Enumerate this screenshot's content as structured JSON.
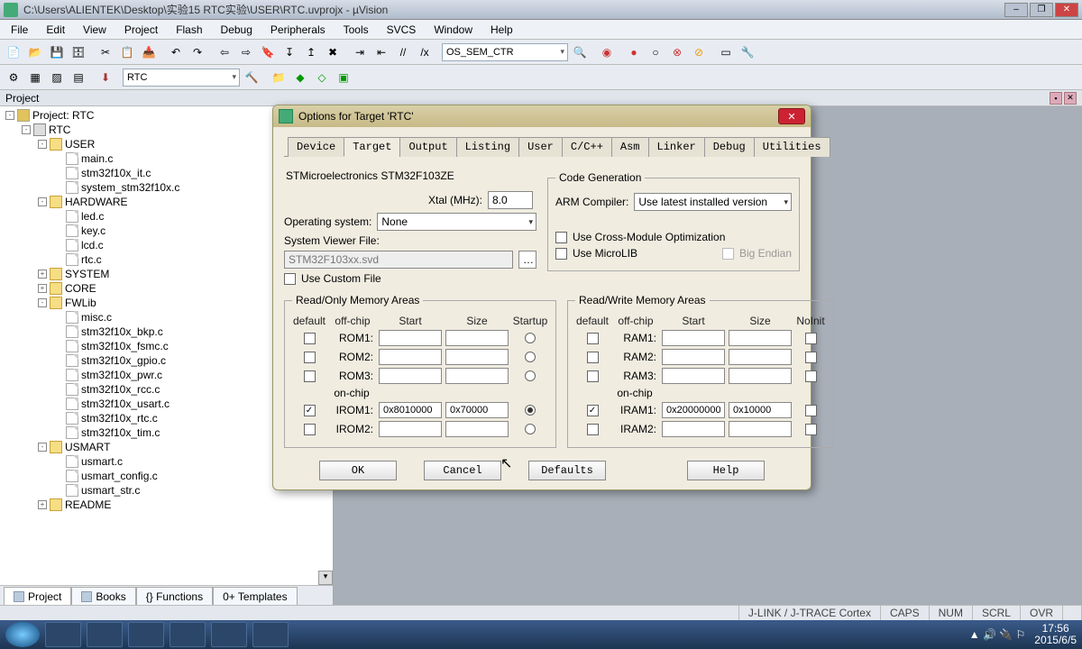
{
  "window": {
    "title": "C:\\Users\\ALIENTEK\\Desktop\\实验15 RTC实验\\USER\\RTC.uvprojx - µVision",
    "min": "–",
    "max": "❐",
    "close": "✕"
  },
  "menu": [
    "File",
    "Edit",
    "View",
    "Project",
    "Flash",
    "Debug",
    "Peripherals",
    "Tools",
    "SVCS",
    "Window",
    "Help"
  ],
  "toolbar2_combo": "RTC",
  "toolbar1_combo": "OS_SEM_CTR",
  "panel_name": "Project",
  "tree": {
    "root": "Project: RTC",
    "target": "RTC",
    "groups": [
      {
        "name": "USER",
        "files": [
          "main.c",
          "stm32f10x_it.c",
          "system_stm32f10x.c"
        ]
      },
      {
        "name": "HARDWARE",
        "files": [
          "led.c",
          "key.c",
          "lcd.c",
          "rtc.c"
        ]
      },
      {
        "name": "SYSTEM",
        "collapsed": true,
        "files": []
      },
      {
        "name": "CORE",
        "collapsed": true,
        "files": []
      },
      {
        "name": "FWLib",
        "files": [
          "misc.c",
          "stm32f10x_bkp.c",
          "stm32f10x_fsmc.c",
          "stm32f10x_gpio.c",
          "stm32f10x_pwr.c",
          "stm32f10x_rcc.c",
          "stm32f10x_usart.c",
          "stm32f10x_rtc.c",
          "stm32f10x_tim.c"
        ]
      },
      {
        "name": "USMART",
        "files": [
          "usmart.c",
          "usmart_config.c",
          "usmart_str.c"
        ]
      },
      {
        "name": "README",
        "collapsed": true,
        "files": []
      }
    ]
  },
  "bottom_tabs": [
    "Project",
    "Books",
    "{} Functions",
    "0+ Templates"
  ],
  "status": {
    "device": "J-LINK / J-TRACE Cortex",
    "caps": "CAPS",
    "num": "NUM",
    "scrl": "SCRL",
    "ovr": "OVR"
  },
  "tray_time": "17:56",
  "tray_date": "2015/6/5",
  "dialog": {
    "title": "Options for Target 'RTC'",
    "tabs": [
      "Device",
      "Target",
      "Output",
      "Listing",
      "User",
      "C/C++",
      "Asm",
      "Linker",
      "Debug",
      "Utilities"
    ],
    "active_tab": "Target",
    "device": "STMicroelectronics STM32F103ZE",
    "xtal_label": "Xtal (MHz):",
    "xtal": "8.0",
    "os_label": "Operating system:",
    "os": "None",
    "svf_label": "System Viewer File:",
    "svf": "STM32F103xx.svd",
    "custom_file": "Use Custom File",
    "codegen": {
      "legend": "Code Generation",
      "arm_compiler_label": "ARM Compiler:",
      "arm_compiler": "Use latest installed version",
      "cross": "Use Cross-Module Optimization",
      "microlib": "Use MicroLIB",
      "bigendian": "Big Endian"
    },
    "ro": {
      "legend": "Read/Only Memory Areas",
      "head": [
        "default",
        "off-chip",
        "Start",
        "Size",
        "Startup"
      ],
      "rows_off": [
        "ROM1:",
        "ROM2:",
        "ROM3:"
      ],
      "onchip": "on-chip",
      "irom1": {
        "lbl": "IROM1:",
        "start": "0x8010000",
        "size": "0x70000",
        "default": true,
        "startup": true
      },
      "irom2": {
        "lbl": "IROM2:"
      }
    },
    "rw": {
      "legend": "Read/Write Memory Areas",
      "head": [
        "default",
        "off-chip",
        "Start",
        "Size",
        "NoInit"
      ],
      "rows_off": [
        "RAM1:",
        "RAM2:",
        "RAM3:"
      ],
      "onchip": "on-chip",
      "iram1": {
        "lbl": "IRAM1:",
        "start": "0x20000000",
        "size": "0x10000",
        "default": true
      },
      "iram2": {
        "lbl": "IRAM2:"
      }
    },
    "buttons": {
      "ok": "OK",
      "cancel": "Cancel",
      "defaults": "Defaults",
      "help": "Help"
    }
  }
}
